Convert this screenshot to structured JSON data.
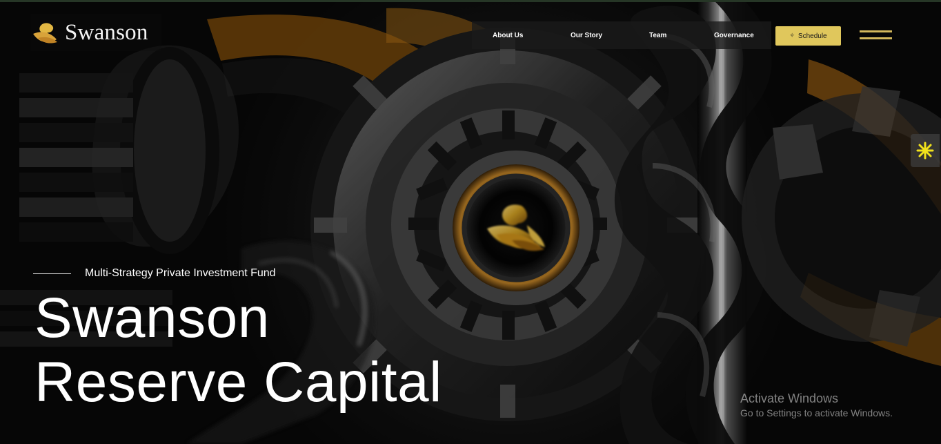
{
  "brand": {
    "name": "Swanson",
    "icon": "swan-logo-icon",
    "accent_color": "#e0c75c"
  },
  "navigation": {
    "items": [
      {
        "label": "About Us"
      },
      {
        "label": "Our Story"
      },
      {
        "label": "Team"
      },
      {
        "label": "Governance"
      }
    ],
    "schedule_label": "Schedule",
    "schedule_icon": "sparkle-icon",
    "menu_icon": "hamburger-menu-icon"
  },
  "side_widget": {
    "icon": "asterisk-icon",
    "icon_color": "#f1e21c"
  },
  "hero": {
    "kicker": "Multi-Strategy Private Investment Fund",
    "title_line_1": "Swanson",
    "title_line_2": "Reserve Capital",
    "background_icon": "gear-machinery-image"
  },
  "system_overlay": {
    "title": "Activate Windows",
    "message": "Go to Settings to activate Windows."
  }
}
